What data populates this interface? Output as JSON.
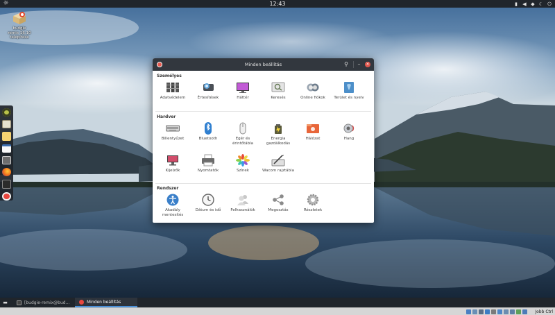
{
  "topbar": {
    "clock": "12:43",
    "menu_icon": "budgie-icon",
    "tray_icons": [
      "battery-icon",
      "volume-icon",
      "notifications-icon",
      "night-light-icon",
      "power-icon"
    ]
  },
  "desktop": {
    "icon_label_lines": [
      "budgie",
      "remix 16.10",
      "telepítése"
    ]
  },
  "dock": {
    "items": [
      "budgie-welcome-icon",
      "image-viewer-icon",
      "notes-icon",
      "calendar-icon",
      "screenshot-icon",
      "firefox-icon",
      "terminal-icon",
      "settings-icon"
    ]
  },
  "window": {
    "title": "Minden beállítás",
    "sections": [
      {
        "title": "Személyes",
        "items": [
          {
            "label": "Adatvédelem",
            "icon": "privacy-icon"
          },
          {
            "label": "Értesítések",
            "icon": "notifications-icon"
          },
          {
            "label": "Háttér",
            "icon": "background-icon"
          },
          {
            "label": "Keresés",
            "icon": "search-icon"
          },
          {
            "label": "Online fiókok",
            "icon": "online-accounts-icon"
          },
          {
            "label": "Terület és nyelv",
            "icon": "region-language-icon"
          }
        ]
      },
      {
        "title": "Hardver",
        "items": [
          {
            "label": "Billentyűzet",
            "icon": "keyboard-icon"
          },
          {
            "label": "Bluetooth",
            "icon": "bluetooth-icon"
          },
          {
            "label": "Egér és érintőtábla",
            "icon": "mouse-icon"
          },
          {
            "label": "Energia gazdálkodás",
            "icon": "power-management-icon"
          },
          {
            "label": "Hálózat",
            "icon": "network-icon"
          },
          {
            "label": "Hang",
            "icon": "sound-icon"
          },
          {
            "label": "Kijelzők",
            "icon": "displays-icon"
          },
          {
            "label": "Nyomtatók",
            "icon": "printers-icon"
          },
          {
            "label": "Színek",
            "icon": "color-icon"
          },
          {
            "label": "Wacom rajztábla",
            "icon": "wacom-icon"
          }
        ]
      },
      {
        "title": "Rendszer",
        "items": [
          {
            "label": "Akadály mentesítés",
            "icon": "accessibility-icon"
          },
          {
            "label": "Dátum és idő",
            "icon": "clock-icon"
          },
          {
            "label": "Felhasználók",
            "icon": "users-icon"
          },
          {
            "label": "Megosztás",
            "icon": "sharing-icon"
          },
          {
            "label": "Részletek",
            "icon": "details-gear-icon"
          }
        ]
      }
    ]
  },
  "taskbar": {
    "tasks": [
      {
        "label": "[budgie-remix@bud...",
        "active": false
      },
      {
        "label": "Minden beállítás",
        "active": true
      }
    ]
  },
  "vm_statusbar": {
    "host_key": "Jobb Ctrl"
  }
}
